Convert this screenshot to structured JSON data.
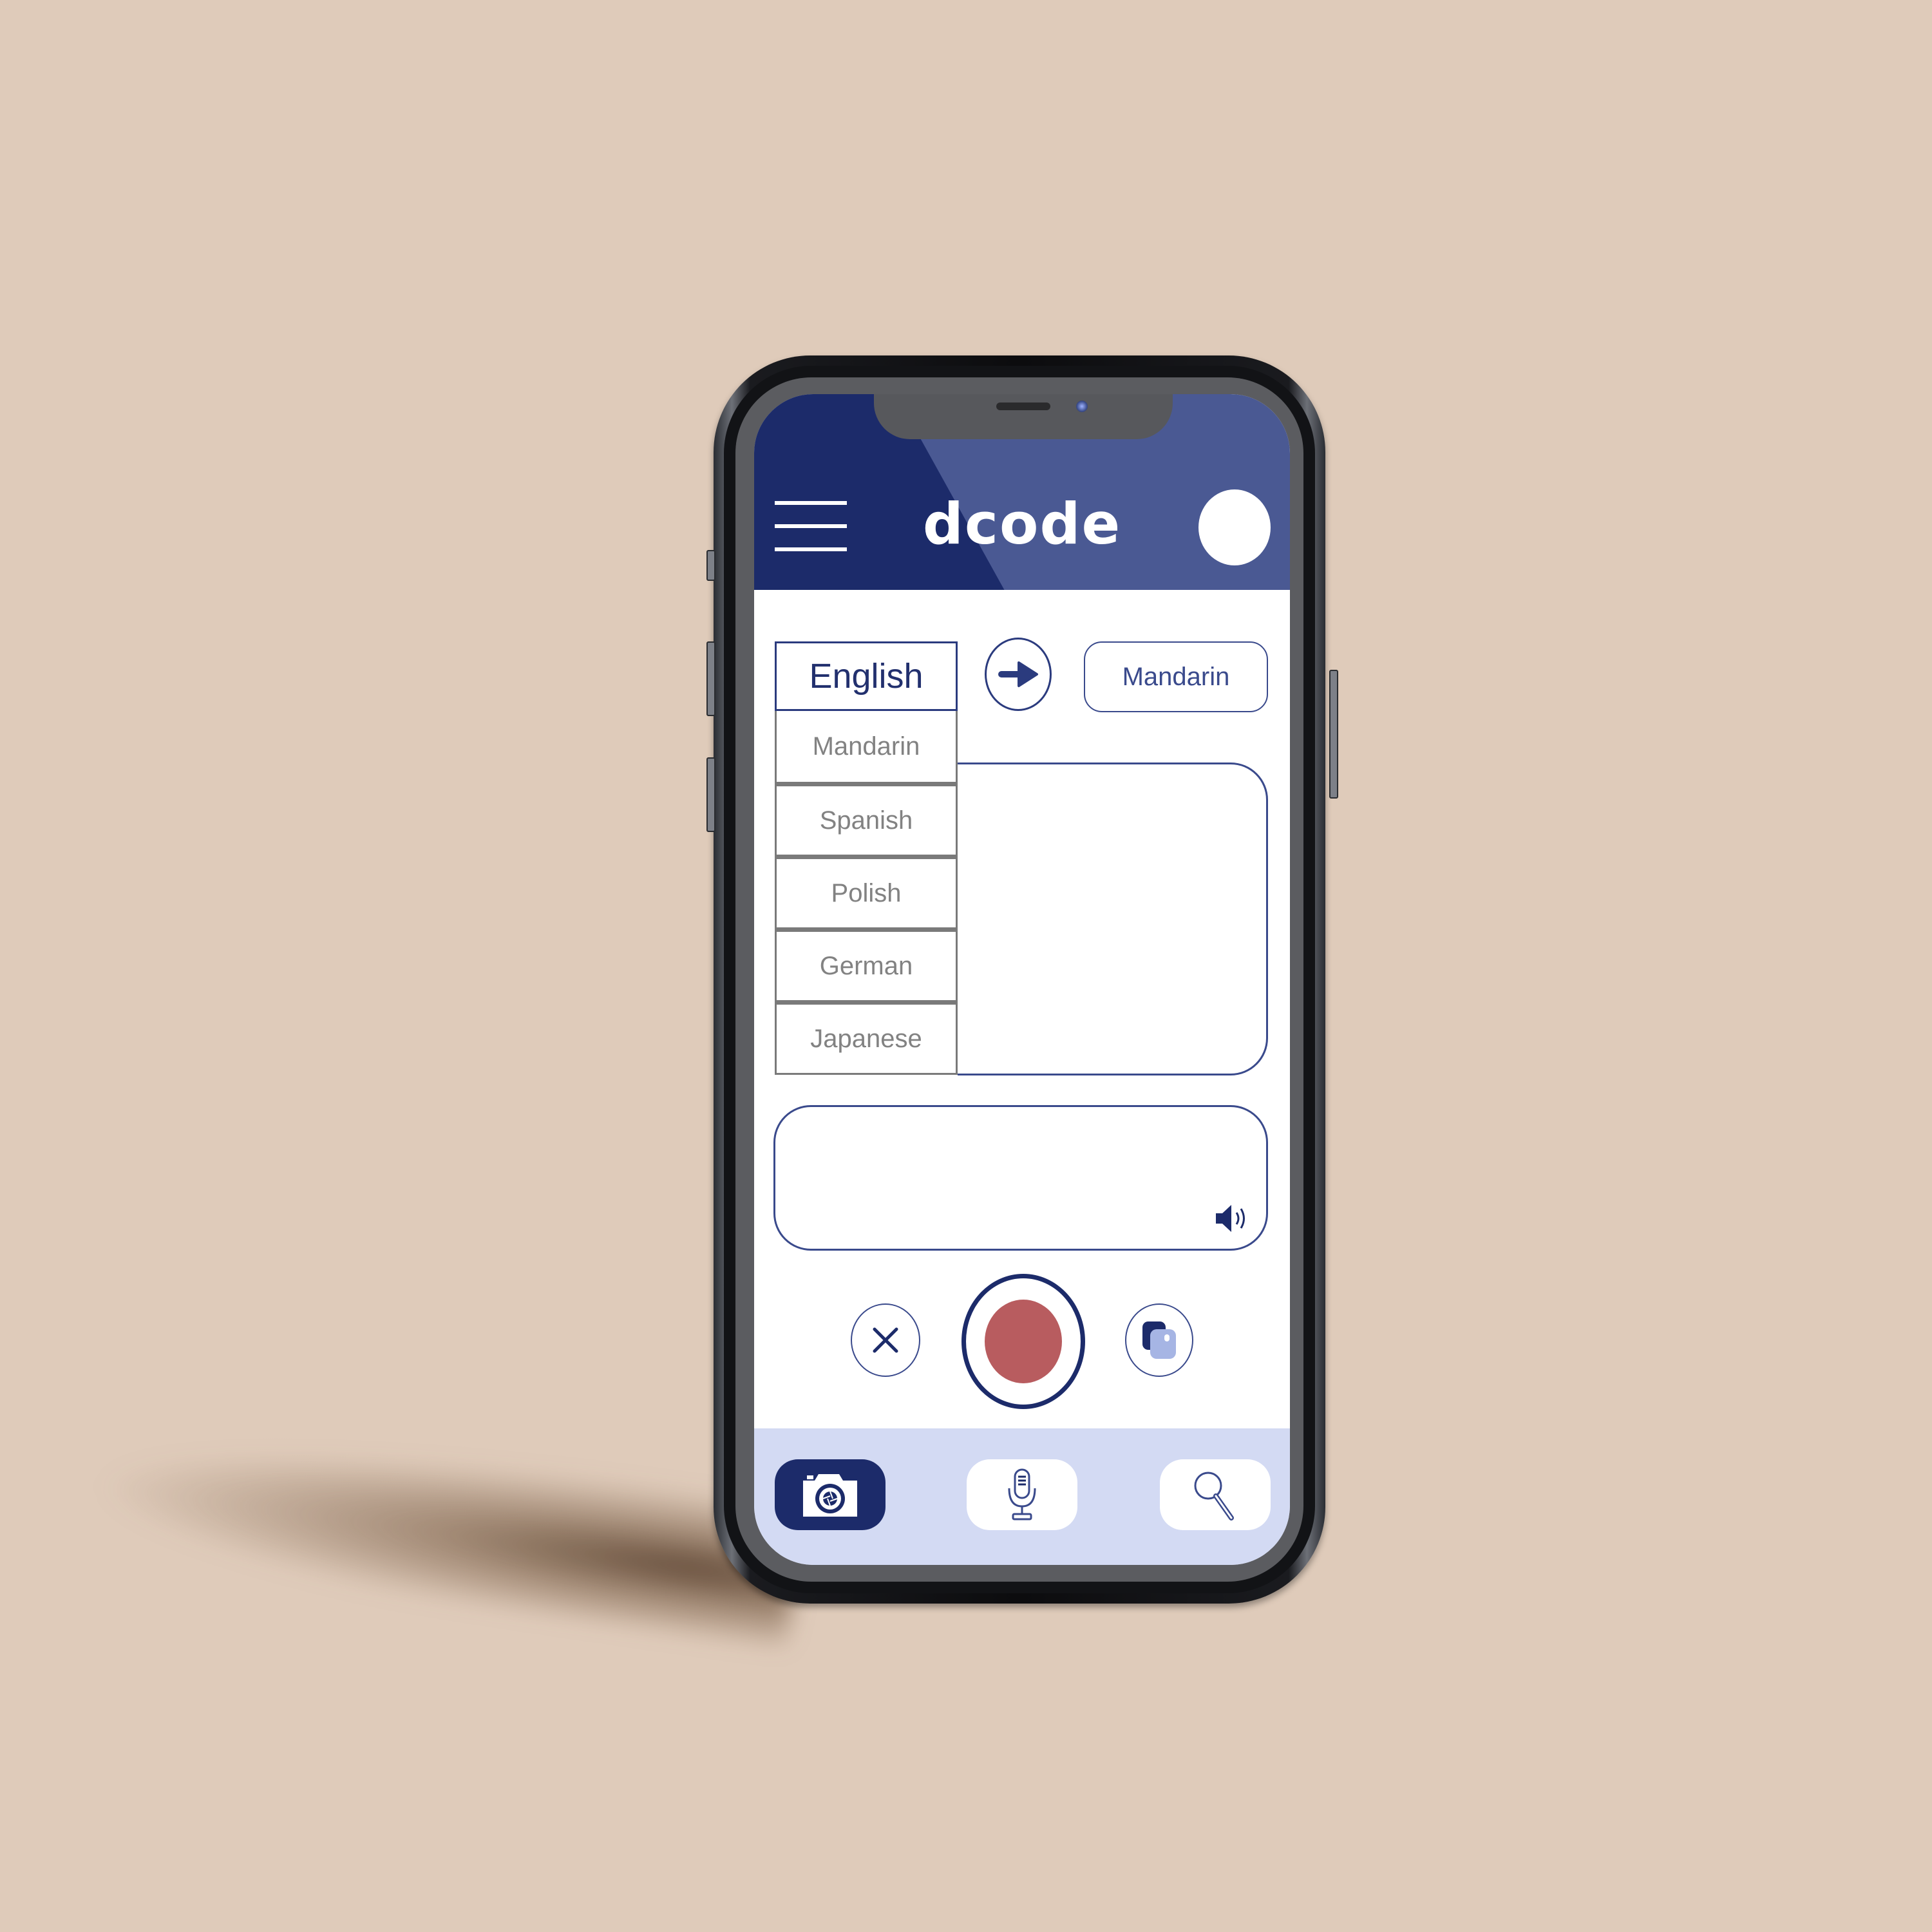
{
  "app": {
    "title": "dcode",
    "accent_color": "#1c2b6a",
    "header_color": "#4a5993",
    "record_color": "#b85c5f",
    "nav_background": "#d3daf3"
  },
  "header": {
    "menu_icon": "hamburger-menu-icon",
    "brand": "dcode",
    "profile_icon": "avatar-circle"
  },
  "translator": {
    "source_language": "English",
    "swap_icon": "arrow-right-icon",
    "target_language": "Mandarin",
    "dropdown_options": [
      "Mandarin",
      "Spanish",
      "Polish",
      "German",
      "Japanese"
    ],
    "input_text": "",
    "output_text": "",
    "output_speaker_icon": "speaker-volume-icon"
  },
  "controls": {
    "clear_icon": "close-x-icon",
    "record_icon": "record-icon",
    "copy_icon": "copy-icon"
  },
  "bottom_nav": {
    "items": [
      {
        "icon": "camera-icon",
        "active": true
      },
      {
        "icon": "microphone-icon",
        "active": false
      },
      {
        "icon": "search-magnifier-icon",
        "active": false
      }
    ]
  }
}
